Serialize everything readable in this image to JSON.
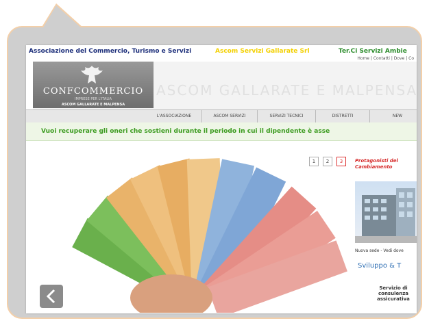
{
  "topbar": {
    "association": "Associazione del Commercio, Turismo e Servizi",
    "highlight": "Ascom Servizi Gallarate Srl",
    "services": "Ter.Ci Servizi Ambie"
  },
  "util_links": "Home | Contatti | Dove | Co",
  "header": {
    "watermark": "ASCOM GALLARATE E MALPENSA",
    "logo": {
      "name": "CONFCOMMERCIO",
      "tagline": "IMPRESE PER L'ITALIA",
      "subtitle": "ASCOM GALLARATE E MALPENSA"
    }
  },
  "nav": {
    "items": [
      "L'ASSOCIAZIONE",
      "ASCOM SERVIZI",
      "SERVIZI TECNICI",
      "DISTRETTI",
      "NEW"
    ]
  },
  "ticker": {
    "text": "Vuoi recuperare gli oneri che sostieni durante il periodo in cui il dipendente è asse"
  },
  "slider": {
    "pages": [
      "1",
      "2",
      "3"
    ],
    "active_page": 3
  },
  "sidebar": {
    "title": "Protagonisti del Cambiamento",
    "caption": "Nuova sede - Vedi dove",
    "logo_text": "Sviluppo & T",
    "service": "Servizio di consulenza assicurativa"
  },
  "colors": {
    "association": "#1c2e7a",
    "highlight": "#f3d000",
    "services": "#2a8b2a",
    "ticker": "#3b9b1f",
    "sidebar_title": "#d62b2b"
  }
}
